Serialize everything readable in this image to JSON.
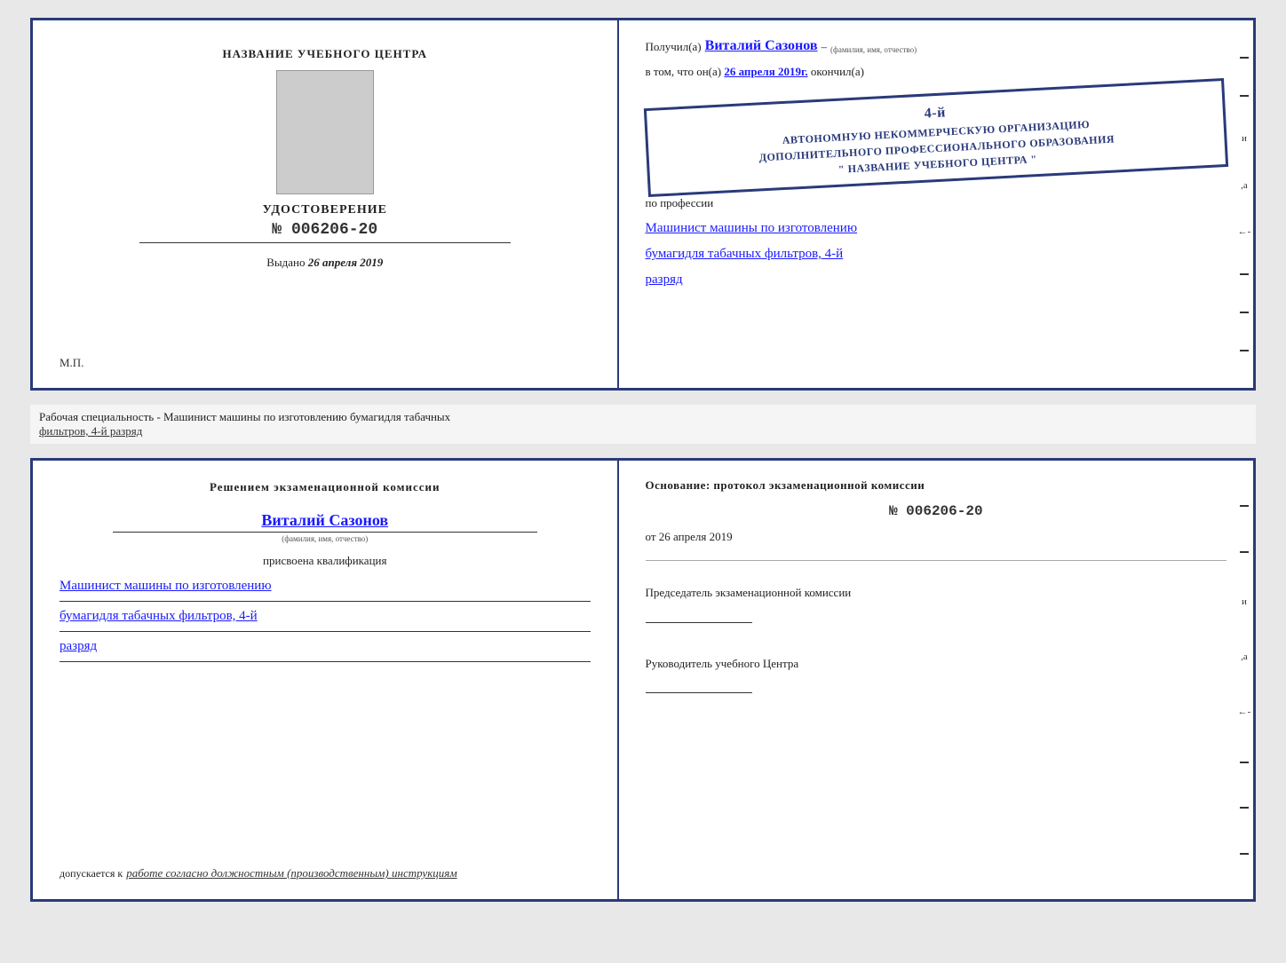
{
  "top_doc": {
    "left": {
      "center_header": "НАЗВАНИЕ УЧЕБНОГО ЦЕНТРА",
      "cert_title": "УДОСТОВЕРЕНИЕ",
      "cert_number": "№ 006206-20",
      "issued_label": "Выдано",
      "issued_date": "26 апреля 2019",
      "mp_label": "М.П."
    },
    "right": {
      "received_prefix": "Получил(а)",
      "recipient_name": "Виталий Сазонов",
      "recipient_hint": "(фамилия, имя, отчество)",
      "in_that": "в том, что он(а)",
      "date_handwritten": "26 апреля 2019г.",
      "finished": "окончил(а)",
      "stamp_line1": "4-й",
      "stamp_line2": "АВТОНОМНУЮ НЕКОММЕРЧЕСКУЮ ОРГАНИЗАЦИЮ",
      "stamp_line3": "ДОПОЛНИТЕЛЬНОГО ПРОФЕССИОНАЛЬНОГО ОБРАЗОВАНИЯ",
      "stamp_line4": "\" НАЗВАНИЕ УЧЕБНОГО ЦЕНТРА \"",
      "profession_label": "по профессии",
      "profession_handwritten1": "Машинист машины по изготовлению",
      "profession_handwritten2": "бумагидля табачных фильтров, 4-й",
      "profession_handwritten3": "разряд"
    }
  },
  "description": {
    "text1": "Рабочая специальность - Машинист машины по изготовлению бумагидля табачных",
    "text2": "фильтров, 4-й разряд"
  },
  "bottom_doc": {
    "left": {
      "commission_title": "Решением  экзаменационной  комиссии",
      "name_handwritten": "Виталий Сазонов",
      "name_hint": "(фамилия, имя, отчество)",
      "qualification_label": "присвоена квалификация",
      "qualification1": "Машинист машины по изготовлению",
      "qualification2": "бумагидля табачных фильтров, 4-й",
      "qualification3": "разряд",
      "allowed_prefix": "допускается к",
      "allowed_text": "работе согласно должностным (производственным) инструкциям"
    },
    "right": {
      "basis_title": "Основание: протокол экзаменационной  комиссии",
      "protocol_number": "№ 006206-20",
      "date_prefix": "от",
      "date": "26 апреля 2019",
      "chairman_title": "Председатель экзаменационной комиссии",
      "director_title": "Руководитель учебного Центра"
    }
  }
}
